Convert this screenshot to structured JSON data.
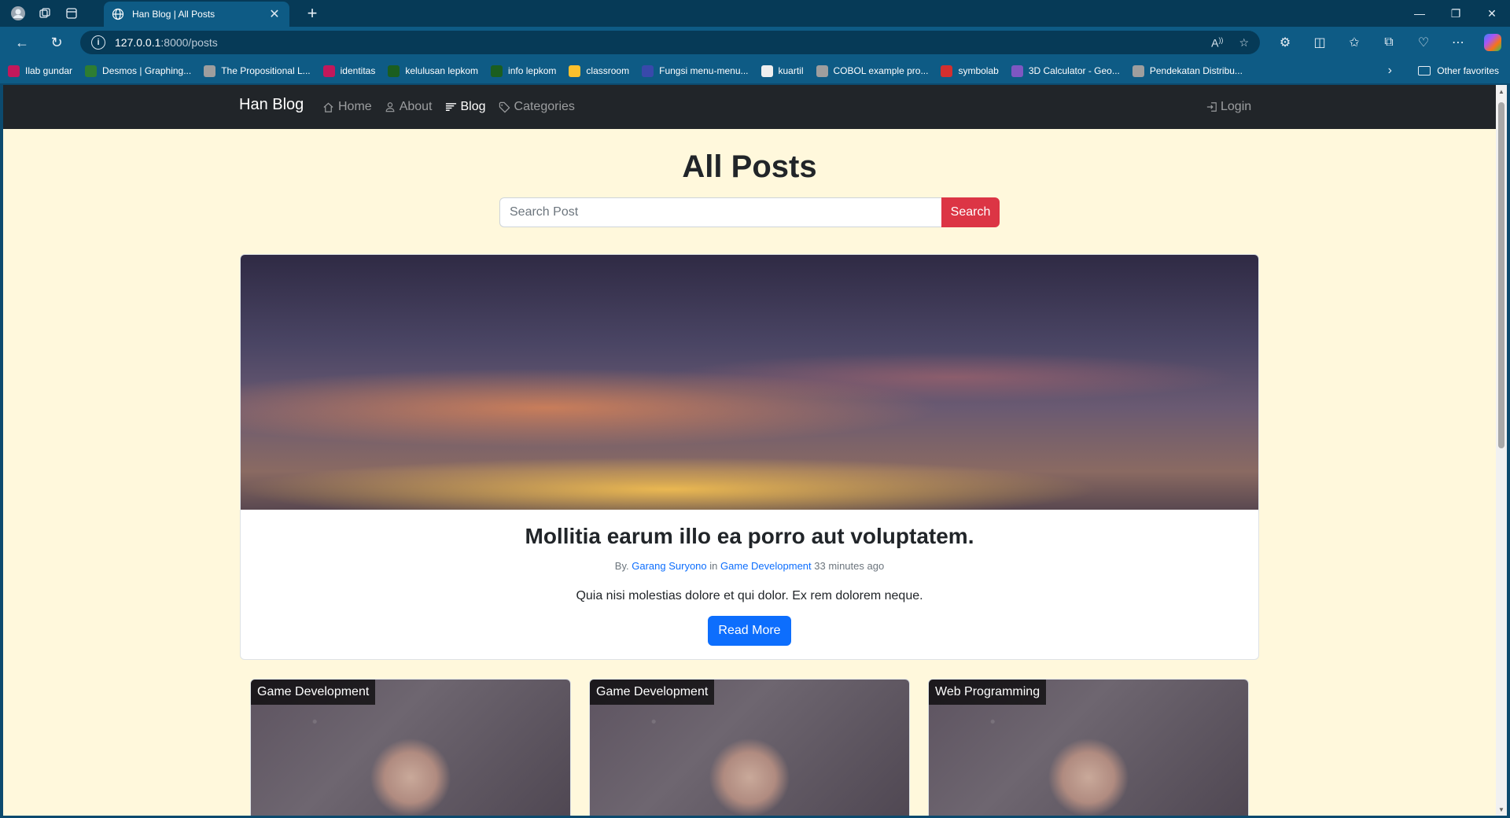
{
  "browser": {
    "tab_title": "Han Blog | All Posts",
    "url_host": "127.0.0.1",
    "url_rest": ":8000/posts",
    "favorites": [
      {
        "label": "Ilab gundar",
        "color": "#c2185b"
      },
      {
        "label": "Desmos | Graphing...",
        "color": "#2e7d32"
      },
      {
        "label": "The Propositional L...",
        "color": "#9e9e9e"
      },
      {
        "label": "identitas",
        "color": "#c2185b"
      },
      {
        "label": "kelulusan lepkom",
        "color": "#1b5e20"
      },
      {
        "label": "info lepkom",
        "color": "#1b5e20"
      },
      {
        "label": "classroom",
        "color": "#fbc02d"
      },
      {
        "label": "Fungsi menu-menu...",
        "color": "#3949ab"
      },
      {
        "label": "kuartil",
        "color": "#eeeeee"
      },
      {
        "label": "COBOL example pro...",
        "color": "#9e9e9e"
      },
      {
        "label": "symbolab",
        "color": "#d32f2f"
      },
      {
        "label": "3D Calculator - Geo...",
        "color": "#7e57c2"
      },
      {
        "label": "Pendekatan Distribu...",
        "color": "#9e9e9e"
      }
    ],
    "other_favorites": "Other favorites"
  },
  "navbar": {
    "brand": "Han Blog",
    "links": [
      {
        "label": "Home",
        "icon": "house-icon"
      },
      {
        "label": "About",
        "icon": "person-icon"
      },
      {
        "label": "Blog",
        "icon": "blog-icon"
      },
      {
        "label": "Categories",
        "icon": "tag-icon"
      }
    ],
    "login": "Login"
  },
  "page": {
    "title": "All Posts",
    "search_placeholder": "Search Post",
    "search_button": "Search"
  },
  "hero_post": {
    "title": "Mollitia earum illo ea porro aut voluptatem.",
    "by": "By.",
    "author": "Garang Suryono",
    "in": "in",
    "category": "Game Development",
    "time": "33 minutes ago",
    "excerpt": "Quia nisi molestias dolore et qui dolor. Ex rem dolorem neque.",
    "button": "Read More"
  },
  "posts": [
    {
      "category": "Game Development"
    },
    {
      "category": "Game Development"
    },
    {
      "category": "Web Programming"
    }
  ],
  "colors": {
    "navbar_bg": "#212529",
    "page_bg": "#fff8dc",
    "search_button": "#dc3545",
    "primary": "#0d6efd"
  }
}
